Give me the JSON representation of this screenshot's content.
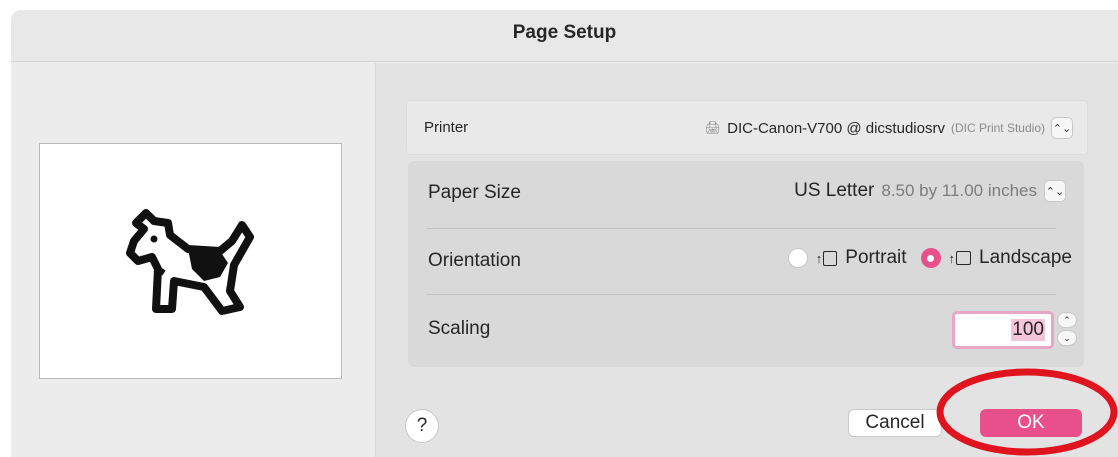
{
  "window": {
    "title": "Page Setup"
  },
  "preview": {
    "icon": "dogcow-icon"
  },
  "printer": {
    "label": "Printer",
    "name": "DIC-Canon-V700 @ dicstudiosrv",
    "location": "(DIC Print Studio)",
    "icon": "printer-icon"
  },
  "paper_size": {
    "label": "Paper Size",
    "value": "US Letter",
    "dimensions": "8.50 by 11.00 inches"
  },
  "orientation": {
    "label": "Orientation",
    "options": [
      {
        "label": "Portrait",
        "selected": false
      },
      {
        "label": "Landscape",
        "selected": true
      }
    ]
  },
  "scaling": {
    "label": "Scaling",
    "value": "100"
  },
  "buttons": {
    "help": "?",
    "cancel": "Cancel",
    "ok": "OK"
  },
  "colors": {
    "accent": "#e8508c",
    "annotation": "#e0141e"
  }
}
